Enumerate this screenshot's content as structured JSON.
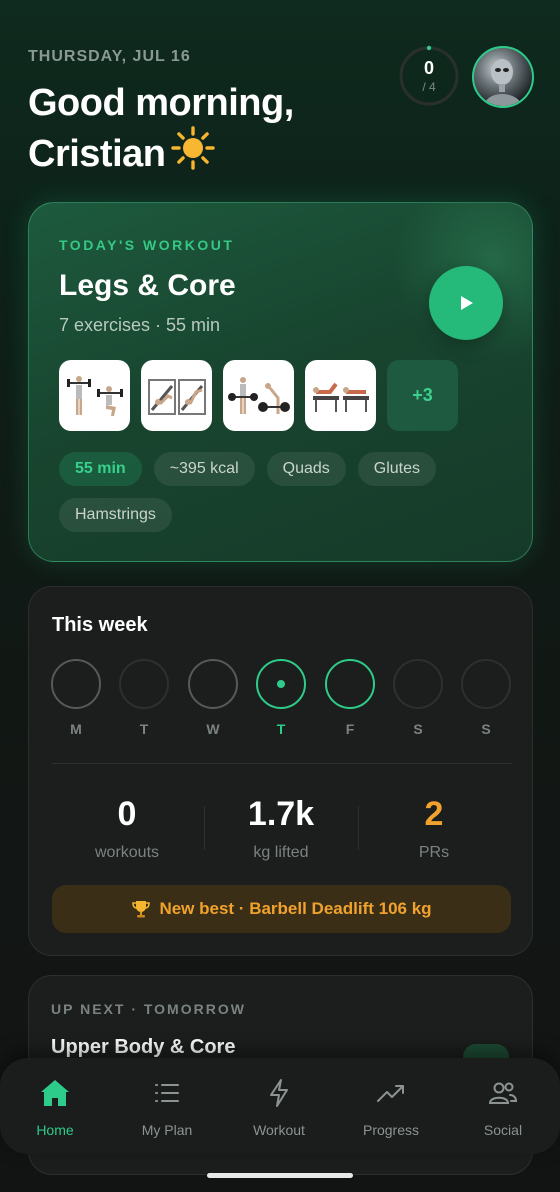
{
  "header": {
    "date": "THURSDAY, JUL 16",
    "greeting_line1": "Good morning,",
    "greeting_line2": "Cristian",
    "ring_value": "0",
    "ring_total": "/ 4",
    "ring_progress": 0
  },
  "todays_workout": {
    "eyebrow": "TODAY'S WORKOUT",
    "title": "Legs & Core",
    "subtitle": "7 exercises · 55 min",
    "more_label": "+3",
    "chips": [
      "55 min",
      "~395 kcal",
      "Quads",
      "Glutes",
      "Hamstrings"
    ]
  },
  "week": {
    "title": "This week",
    "days": [
      {
        "label": "M",
        "state": "missed"
      },
      {
        "label": "T",
        "state": "rest"
      },
      {
        "label": "W",
        "state": "missed"
      },
      {
        "label": "T",
        "state": "today"
      },
      {
        "label": "F",
        "state": "planned"
      },
      {
        "label": "S",
        "state": "rest"
      },
      {
        "label": "S",
        "state": "rest"
      }
    ],
    "stats": [
      {
        "value": "0",
        "label": "workouts"
      },
      {
        "value": "1.7k",
        "label": "kg lifted"
      },
      {
        "value": "2",
        "label": "PRs"
      }
    ],
    "pr_banner": "New best · Barbell Deadlift 106 kg"
  },
  "up_next": {
    "eyebrow": "UP NEXT · TOMORROW",
    "title": "Upper Body & Core"
  },
  "tabbar": {
    "items": [
      {
        "label": "Home",
        "icon": "home-icon",
        "active": true
      },
      {
        "label": "My Plan",
        "icon": "list-icon",
        "active": false
      },
      {
        "label": "Workout",
        "icon": "lightning-icon",
        "active": false
      },
      {
        "label": "Progress",
        "icon": "trending-up-icon",
        "active": false
      },
      {
        "label": "Social",
        "icon": "people-icon",
        "active": false
      }
    ]
  },
  "colors": {
    "accent": "#2ecc8a",
    "gold": "#f0a22c",
    "card": "#1b1e1c"
  }
}
